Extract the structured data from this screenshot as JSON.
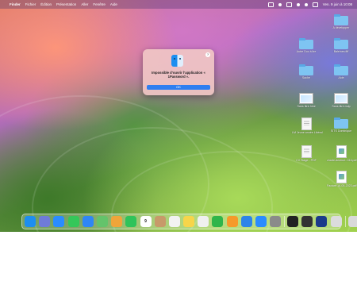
{
  "menubar": {
    "app_name": "Finder",
    "items": [
      "Fichier",
      "Édition",
      "Présentation",
      "Aller",
      "Fenêtre",
      "Aide"
    ],
    "clock": "Ven. 9 juin à 10:08"
  },
  "dialog": {
    "help": "?",
    "message": "Impossible d’ouvrir l’application « 1Password ».",
    "ok_label": "OK"
  },
  "desktop": {
    "items": [
      {
        "label": "A développer",
        "type": "folder"
      },
      {
        "label": "Autre Doc à lire",
        "type": "folder"
      },
      {
        "label": "Baleines.fiff",
        "type": "folder"
      },
      {
        "label": "Sache",
        "type": "folder"
      },
      {
        "label": "Aide",
        "type": "folder"
      },
      {
        "label": "Sans titre.html",
        "type": "screenshot"
      },
      {
        "label": "Sans titre.mdp",
        "type": "screenshot"
      },
      {
        "label": "LM Jeune année Libéral",
        "type": "document"
      },
      {
        "label": "SITS Dominique",
        "type": "folder"
      },
      {
        "label": "CV Stage - PDF",
        "type": "document"
      },
      {
        "label": "charte-dentisti...016.pdf",
        "type": "pdf"
      },
      {
        "label": "Facture 16-05-2023.pdf",
        "type": "pdf"
      }
    ]
  },
  "dock": {
    "calendar_day": "9",
    "apps": [
      {
        "name": "finder",
        "color": "#1d8ef0"
      },
      {
        "name": "launchpad",
        "color": "#6f7bd8"
      },
      {
        "name": "safari",
        "color": "#2a8cff"
      },
      {
        "name": "messages",
        "color": "#35c759"
      },
      {
        "name": "mail",
        "color": "#2f86f5"
      },
      {
        "name": "maps",
        "color": "#64c36b"
      },
      {
        "name": "photos",
        "color": "#f0a53a"
      },
      {
        "name": "facetime",
        "color": "#2fc35a"
      },
      {
        "name": "calendar",
        "color": "#ffffff"
      },
      {
        "name": "contacts",
        "color": "#c79a6a"
      },
      {
        "name": "reminders",
        "color": "#f2f2f2"
      },
      {
        "name": "notes",
        "color": "#f7d54a"
      },
      {
        "name": "freeform",
        "color": "#f0f0f0"
      },
      {
        "name": "numbers",
        "color": "#2fb54a"
      },
      {
        "name": "pages",
        "color": "#f59a2a"
      },
      {
        "name": "keynote",
        "color": "#2e84e8"
      },
      {
        "name": "app-store",
        "color": "#2a8cff"
      },
      {
        "name": "system-settings",
        "color": "#8a8a8a"
      },
      {
        "name": "terminal",
        "color": "#222222"
      },
      {
        "name": "activity-monitor",
        "color": "#333333"
      },
      {
        "name": "1password",
        "color": "#1b3b8a"
      },
      {
        "name": "preview",
        "color": "#dcdcdc"
      },
      {
        "name": "trash",
        "color": "#d9d9d9"
      }
    ]
  }
}
